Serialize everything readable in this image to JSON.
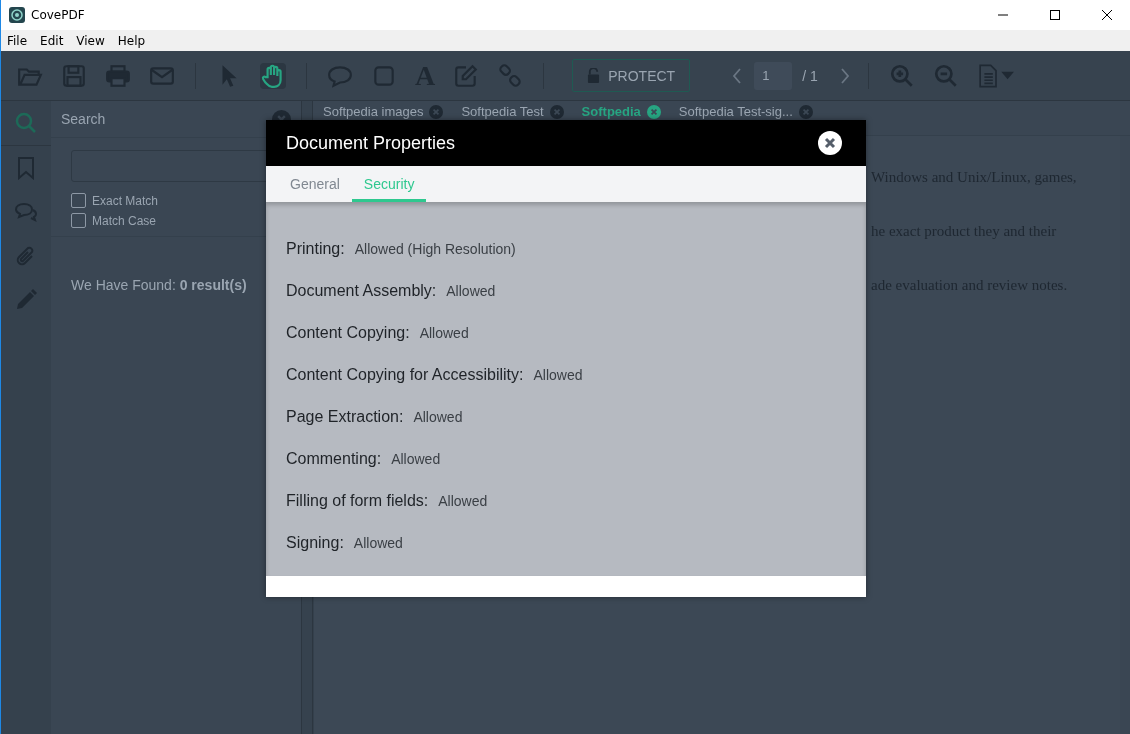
{
  "window": {
    "title": "CovePDF"
  },
  "menu": [
    "File",
    "Edit",
    "View",
    "Help"
  ],
  "tools": [
    {
      "kind": "open",
      "selected": false
    },
    {
      "kind": "save",
      "selected": false
    },
    {
      "kind": "print",
      "selected": false
    },
    {
      "kind": "mail",
      "selected": false
    },
    {
      "kind": "sep"
    },
    {
      "kind": "pointer",
      "selected": false
    },
    {
      "kind": "hand",
      "selected": true
    },
    {
      "kind": "sep"
    },
    {
      "kind": "comment",
      "selected": false
    },
    {
      "kind": "square",
      "selected": false
    },
    {
      "kind": "text",
      "selected": false
    },
    {
      "kind": "edit",
      "selected": false
    },
    {
      "kind": "link",
      "selected": false
    },
    {
      "kind": "sep"
    }
  ],
  "text_tool_glyph": "A",
  "protect": "PROTECT",
  "pager": {
    "page": "1",
    "total": "/ 1"
  },
  "rail": [
    {
      "kind": "search",
      "selected": true
    },
    {
      "kind": "bookmark",
      "selected": false
    },
    {
      "kind": "comments",
      "selected": false
    },
    {
      "kind": "attachment",
      "selected": false
    },
    {
      "kind": "pencil",
      "selected": false
    }
  ],
  "search_panel": {
    "title": "Search",
    "options": [
      {
        "label": "Exact Match",
        "checked": false
      },
      {
        "label": "Match Case",
        "checked": false
      }
    ],
    "result": "We Have Found: **0 result(s)**"
  },
  "doc_tabs": [
    {
      "label": "Softpedia images",
      "selected": false
    },
    {
      "label": "Softpedia Test",
      "selected": false
    },
    {
      "label": "Softpedia",
      "selected": true
    },
    {
      "label": "Softpedia Test-sig...",
      "selected": false
    }
  ],
  "document": {
    "lines": [
      "Windows and Unix/Linux, games,",
      "he exact product they and their",
      "ade evaluation and review notes."
    ]
  },
  "dialog": {
    "title": "Document Properties",
    "tabs": [
      {
        "label": "General",
        "selected": false
      },
      {
        "label": "Security",
        "selected": true
      }
    ],
    "properties": [
      {
        "label": "Printing:",
        "value": "Allowed (High Resolution)"
      },
      {
        "label": "Document Assembly:",
        "value": "Allowed"
      },
      {
        "label": "Content Copying:",
        "value": "Allowed"
      },
      {
        "label": "Content Copying for Accessibility:",
        "value": "Allowed"
      },
      {
        "label": "Page Extraction:",
        "value": "Allowed"
      },
      {
        "label": "Commenting:",
        "value": "Allowed"
      },
      {
        "label": "Filling of form fields:",
        "value": "Allowed"
      },
      {
        "label": "Signing:",
        "value": "Allowed"
      }
    ]
  }
}
